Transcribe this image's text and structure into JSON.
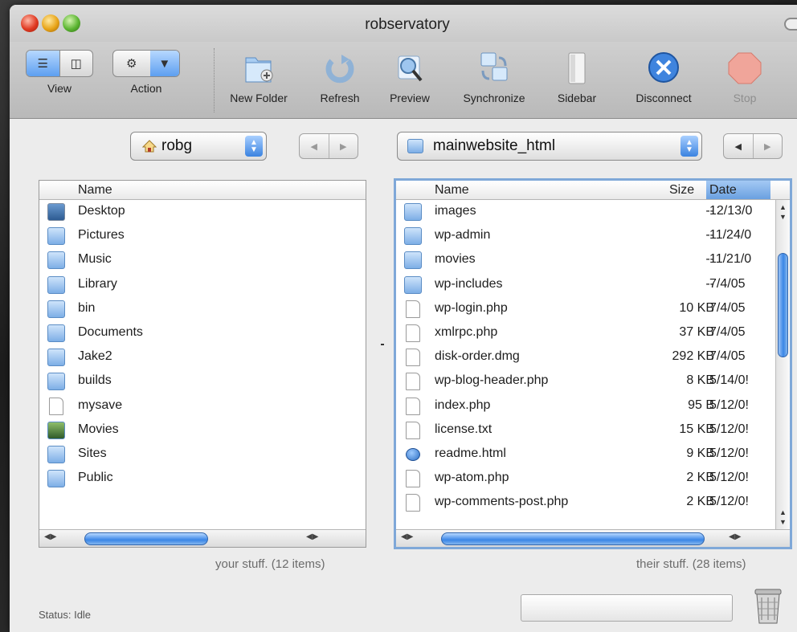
{
  "window": {
    "title": "robservatory"
  },
  "toolbar": {
    "items": [
      {
        "label": "View",
        "icon": "view-mode-segment"
      },
      {
        "label": "Action",
        "icon": "gear-menu"
      },
      {
        "label": "New Folder",
        "icon": "new-folder-icon"
      },
      {
        "label": "Refresh",
        "icon": "refresh-icon"
      },
      {
        "label": "Preview",
        "icon": "preview-magnifier-icon"
      },
      {
        "label": "Synchronize",
        "icon": "synchronize-icon"
      },
      {
        "label": "Sidebar",
        "icon": "sidebar-icon"
      },
      {
        "label": "Disconnect",
        "icon": "disconnect-icon"
      },
      {
        "label": "Stop",
        "icon": "stop-icon"
      }
    ]
  },
  "local": {
    "path": "robg",
    "column_name": "Name",
    "items": [
      {
        "name": "Desktop",
        "kind": "desktop"
      },
      {
        "name": "Pictures",
        "kind": "pictures"
      },
      {
        "name": "Music",
        "kind": "music"
      },
      {
        "name": "Library",
        "kind": "library"
      },
      {
        "name": "bin",
        "kind": "folder"
      },
      {
        "name": "Documents",
        "kind": "documents"
      },
      {
        "name": "Jake2",
        "kind": "folder"
      },
      {
        "name": "builds",
        "kind": "folder"
      },
      {
        "name": "mysave",
        "kind": "file"
      },
      {
        "name": "Movies",
        "kind": "movies"
      },
      {
        "name": "Sites",
        "kind": "sites"
      },
      {
        "name": "Public",
        "kind": "public"
      }
    ],
    "summary": "your stuff. (12 items)"
  },
  "remote": {
    "path": "mainwebsite_html",
    "columns": {
      "name": "Name",
      "size": "Size",
      "date": "Date"
    },
    "items": [
      {
        "name": "images",
        "size": "--",
        "date": "12/13/0",
        "kind": "folder"
      },
      {
        "name": "wp-admin",
        "size": "--",
        "date": "11/24/0",
        "kind": "folder"
      },
      {
        "name": "movies",
        "size": "--",
        "date": "11/21/0",
        "kind": "folder"
      },
      {
        "name": "wp-includes",
        "size": "--",
        "date": "7/4/05",
        "kind": "folder"
      },
      {
        "name": "wp-login.php",
        "size": "10 KB",
        "date": "7/4/05",
        "kind": "file"
      },
      {
        "name": "xmlrpc.php",
        "size": "37 KB",
        "date": "7/4/05",
        "kind": "file"
      },
      {
        "name": "disk-order.dmg",
        "size": "292 KB",
        "date": "7/4/05",
        "kind": "dmg"
      },
      {
        "name": "wp-blog-header.php",
        "size": "8 KB",
        "date": "5/14/0!",
        "kind": "file"
      },
      {
        "name": "index.php",
        "size": "95 B",
        "date": "5/12/0!",
        "kind": "file"
      },
      {
        "name": "license.txt",
        "size": "15 KB",
        "date": "5/12/0!",
        "kind": "text"
      },
      {
        "name": "readme.html",
        "size": "9 KB",
        "date": "5/12/0!",
        "kind": "html"
      },
      {
        "name": "wp-atom.php",
        "size": "2 KB",
        "date": "5/12/0!",
        "kind": "file"
      },
      {
        "name": "wp-comments-post.php",
        "size": "2 KB",
        "date": "5/12/0!",
        "kind": "file"
      }
    ],
    "summary": "their stuff. (28 items)"
  },
  "status": {
    "text": "Status: Idle"
  },
  "colors": {
    "accent": "#3a86e6",
    "window_bg": "#ececec",
    "focus_ring": "#7fa8d8"
  }
}
